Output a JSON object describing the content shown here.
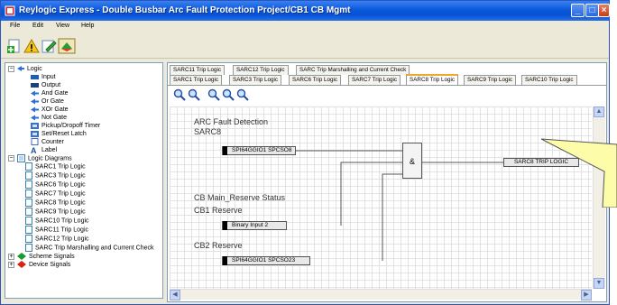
{
  "window": {
    "title": "Reylogic Express - Double Busbar Arc Fault Protection Project/CB1 CB Mgmt"
  },
  "menu": [
    "File",
    "Edit",
    "View",
    "Help"
  ],
  "toolbar": {
    "icons": [
      "add-icon",
      "warning-icon",
      "edit-icon",
      "nav-icon"
    ]
  },
  "tree": {
    "logic_label": "Logic",
    "logic_items": [
      "Input",
      "Output",
      "And Gate",
      "Or Gate",
      "XOr Gate",
      "Not Gate",
      "Pickup/Dropoff Timer",
      "Set/Reset Latch",
      "Counter",
      "Label"
    ],
    "diagrams_label": "Logic Diagrams",
    "diagrams": [
      "SARC1 Trip Logic",
      "SARC3 Trip Logic",
      "SARC6 Trip Logic",
      "SARC7 Trip Logic",
      "SARC8 Trip Logic",
      "SARC9 Trip Logic",
      "SARC10 Trip Logic",
      "SARC11 Trip Logic",
      "SARC12 Trip Logic",
      "SARC Trip Marshalling and Current Check"
    ],
    "scheme_label": "Scheme Signals",
    "device_label": "Device Signals"
  },
  "tabs_row1": [
    "SARC11 Trip Logic",
    "SARC12 Trip Logic",
    "SARC Trip Marshalling and Current Check"
  ],
  "tabs_row2": [
    "SARC1 Trip Logic",
    "SARC3 Trip Logic",
    "SARC6 Trip Logic",
    "SARC7 Trip Logic",
    "SARC8 Trip Logic",
    "SARC9 Trip Logic",
    "SARC10 Trip Logic"
  ],
  "active_tab": "SARC8 Trip Logic",
  "diagram": {
    "heading1": "ARC Fault Detection",
    "heading2": "SARC8",
    "input1": "SPI64GGIO1 SPCSO8",
    "status_heading": "CB Main_Reserve Status",
    "cb1_label": "CB1 Reserve",
    "input2": "Binary Input 2",
    "cb2_label": "CB2 Reserve",
    "input3": "SPI64GGIO1 SPCSO23",
    "gate_symbol": "&",
    "output": "SARC8 TRIP LOGIC"
  },
  "colors": {
    "titlebar": "#0a59db",
    "active_tab_accent": "#f3a72a",
    "callout": "#fdfca8"
  }
}
